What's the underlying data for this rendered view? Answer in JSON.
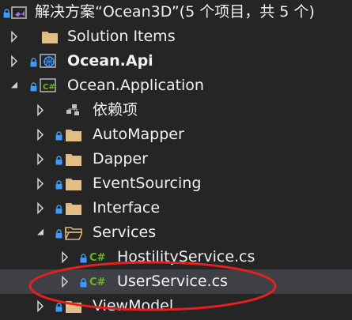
{
  "solution": {
    "label": "解决方案“Ocean3D”(5 个项目，共 5 个)"
  },
  "items": {
    "solution_items": "Solution Items",
    "api": "Ocean.Api",
    "application": "Ocean.Application",
    "dependencies": "依赖项",
    "automapper": "AutoMapper",
    "dapper": "Dapper",
    "eventsourcing": "EventSourcing",
    "interface": "Interface",
    "services": "Services",
    "hostility": "HostilityService.cs",
    "userservice": "UserService.cs",
    "viewmodel": "ViewModel"
  },
  "colors": {
    "background": "#252526",
    "selected": "#3f3f46",
    "folder": "#dcb67a",
    "csharp_green": "#68b723",
    "lock_blue": "#3c9bff",
    "annotation_red": "#e8201d"
  },
  "icons": {
    "solution": "visual-studio-solution-icon",
    "folder": "folder-icon",
    "web_project": "web-project-icon",
    "csharp_project": "csharp-project-icon",
    "dependencies": "dependencies-icon",
    "csharp_file": "csharp-file-icon",
    "lock": "lock-icon"
  }
}
